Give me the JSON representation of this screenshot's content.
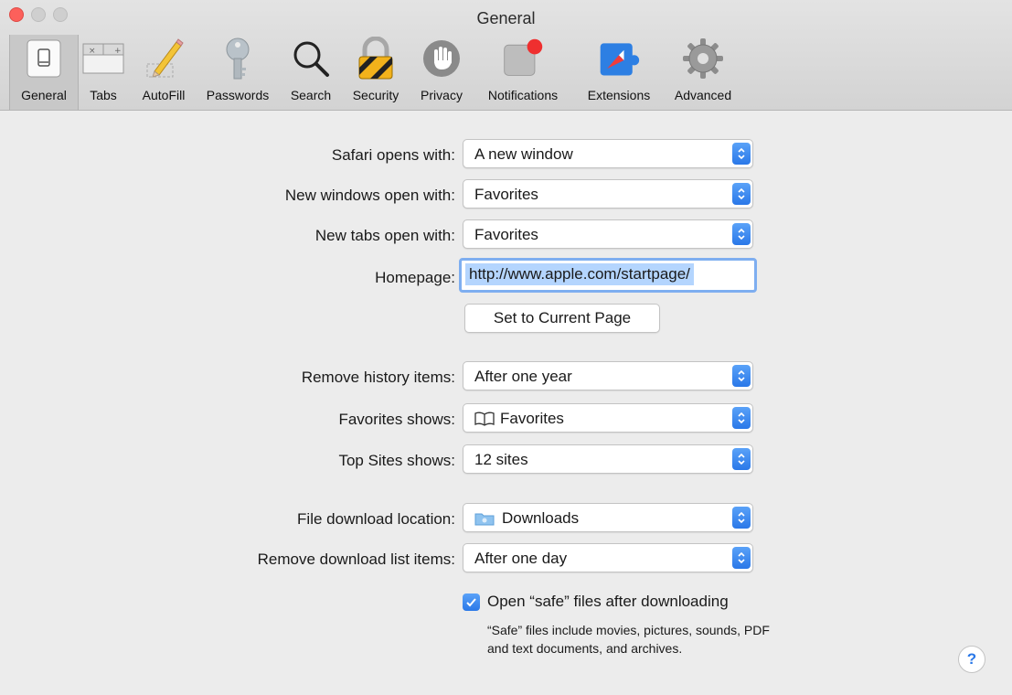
{
  "window": {
    "title": "General"
  },
  "toolbar": {
    "items": [
      {
        "label": "General",
        "icon": "general-switch-icon",
        "selected": true
      },
      {
        "label": "Tabs",
        "icon": "tabs-icon"
      },
      {
        "label": "AutoFill",
        "icon": "pencil-icon"
      },
      {
        "label": "Passwords",
        "icon": "key-icon"
      },
      {
        "label": "Search",
        "icon": "magnifier-icon"
      },
      {
        "label": "Security",
        "icon": "padlock-icon"
      },
      {
        "label": "Privacy",
        "icon": "hand-icon"
      },
      {
        "label": "Notifications",
        "icon": "notification-badge-icon"
      },
      {
        "label": "Extensions",
        "icon": "puzzle-compass-icon"
      },
      {
        "label": "Advanced",
        "icon": "gear-icon"
      }
    ]
  },
  "settings": {
    "safari_opens_with": {
      "label": "Safari opens with:",
      "value": "A new window"
    },
    "new_windows_open_with": {
      "label": "New windows open with:",
      "value": "Favorites"
    },
    "new_tabs_open_with": {
      "label": "New tabs open with:",
      "value": "Favorites"
    },
    "homepage": {
      "label": "Homepage:",
      "value": "http://www.apple.com/startpage/"
    },
    "set_current_page": {
      "label": "Set to Current Page"
    },
    "remove_history_items": {
      "label": "Remove history items:",
      "value": "After one year"
    },
    "favorites_shows": {
      "label": "Favorites shows:",
      "value": "Favorites",
      "icon": "book-icon"
    },
    "top_sites_shows": {
      "label": "Top Sites shows:",
      "value": "12 sites"
    },
    "file_download_location": {
      "label": "File download location:",
      "value": "Downloads",
      "icon": "folder-icon"
    },
    "remove_download_list_items": {
      "label": "Remove download list items:",
      "value": "After one day"
    },
    "open_safe_files": {
      "label": "Open “safe” files after downloading",
      "checked": true,
      "note": "“Safe” files include movies, pictures, sounds, PDF and text documents, and archives."
    }
  },
  "help": {
    "label": "?"
  },
  "colors": {
    "accent": "#2a78e8",
    "close": "#fc605b",
    "selection": "#b4d5fe"
  }
}
